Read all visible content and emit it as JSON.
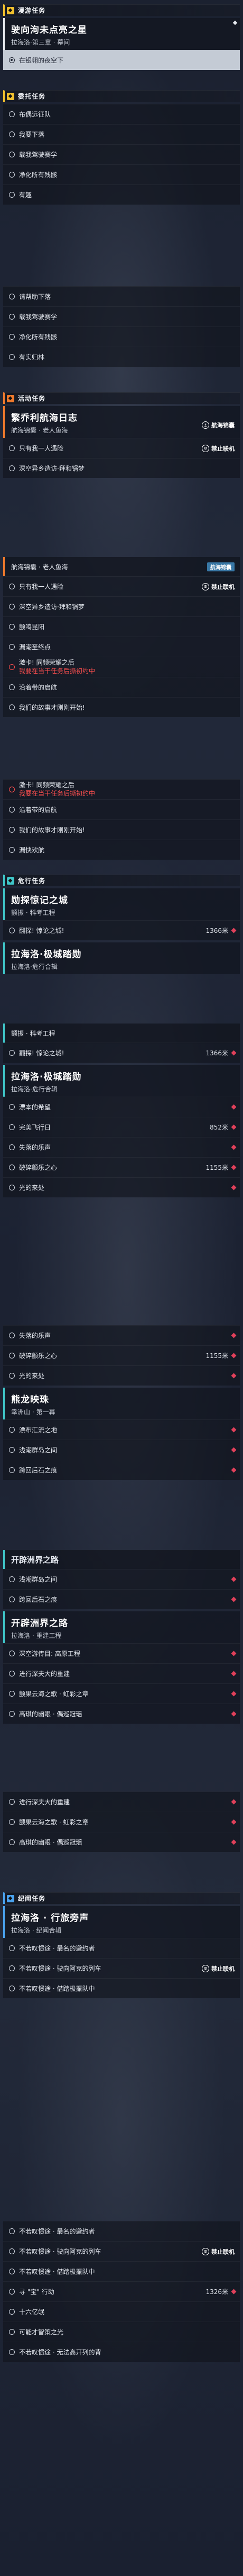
{
  "top": {
    "category": "漫游任务",
    "card_title": "驶向洵未点亮之星",
    "card_sub": "拉海洛·第三章 · 幕间",
    "active_obj": "在银翎的夜空下"
  },
  "daily": {
    "category": "委托任务",
    "items": [
      "布偶远征队",
      "我要下落",
      "载我驾驶赛学",
      "净化所有残骸",
      "有趣"
    ],
    "items_b": [
      "请帮助下落",
      "载我驾驶赛学",
      "净化所有残骸",
      "有实归林"
    ]
  },
  "activity": {
    "category": "活动任务",
    "card_title": "繁乔利航海日志",
    "card_sub": "航海锦囊 · 老人鱼海",
    "badge_online": "航海锦囊",
    "badge_offline": "禁止联机",
    "obj1": "只有我一人遇险",
    "obj2": "深空异乡造访·拜和锅梦",
    "card2_sub": "航海锦囊 · 老人鱼海",
    "obj3": "只有我一人遇险",
    "obj4": "深空异乡造访·拜和锅梦",
    "obj5": "颤鸣昆阳",
    "obj6": "漏潮至终点",
    "red_line1": "激卡! 同频荣耀之后",
    "red_line2": "我要在当干任务后撕初约中",
    "obj7": "沿着带的启航",
    "obj8": "我们的故事才刚刚开始!",
    "red_b1": "激卡! 同频荣耀之后",
    "red_b2": "我要在当干任务后撕初约中",
    "obj9": "沿着带的启航",
    "obj10": "我们的故事才刚刚开始!",
    "obj11": "漏快欢航"
  },
  "explore": {
    "category": "危行任务",
    "card1_title": "勋探惊记之城",
    "card1_sub": "颤振 · 科考工程",
    "obj1": "翻探! 惊论之城!",
    "obj1_dist": "1366米",
    "card2_title": "拉海洛·极城踏勋",
    "card2_sub": "拉海洛·危行合辑",
    "sub_hdr": "颤振 · 科考工程",
    "obj2": "翻探! 惊论之城!",
    "obj2_dist": "1366米",
    "card3_title": "拉海洛·极城踏勋",
    "card3_sub": "拉海洛·危行合辑",
    "list1": [
      "漂本的希望",
      "完美飞行日",
      "失落的乐声",
      "破碎颤乐之心",
      "光的来处"
    ],
    "list1_dist": [
      "",
      "852米",
      "",
      "1155米",
      ""
    ],
    "list2": [
      "失落的乐声",
      "破碎颤乐之心",
      "光的来处"
    ],
    "list2_dist": [
      "",
      "1155米",
      ""
    ],
    "card4_title": "熊龙映珠",
    "card4_sub": "幸洲山 · 第一幕",
    "list3": [
      "漂布汇流之地",
      "浅潮群岛之间",
      "跨回后石之痕"
    ],
    "hdr_partial": "开辟洲界之路",
    "list4": [
      "浅潮群岛之间",
      "跨回后石之痕"
    ],
    "card5_title": "开辟洲界之路",
    "card5_sub": "拉海洛 · 重建工程",
    "list5": [
      "深空游传目: 高原工程",
      "进行深夫大的重建",
      "颤果云海之歌 · 虹彩之章",
      "高琪的幽眼 · 偶巡冠瑶"
    ],
    "list6": [
      "进行深夫大的重建",
      "颤果云海之歌 · 虹彩之章",
      "高琪的幽眼 · 偶巡冠瑶"
    ]
  },
  "record": {
    "category": "纪闻任务",
    "card_title": "拉海洛 · 行旅旁声",
    "card_sub": "拉海洛 · 纪闻合辑",
    "badge_offline": "禁止联机",
    "list1": [
      "不若叹惯途 · 最名的避约者",
      "不若叹惯途 · 驶向阿克的列车",
      "不若叹惯途 · 借踏极振队中"
    ],
    "list2": [
      "不若叹惯途 · 最名的避约者",
      "不若叹惯途 · 驶向阿克的列车",
      "不若叹惯途 · 借踏极振队中",
      "寻 \"宝\" 行动",
      "十六亿氓",
      "可能才智策之光",
      "不若叹惯途 · 无法高开列的背"
    ],
    "list2_dist": [
      "",
      "",
      "",
      "1326米",
      "",
      "",
      ""
    ]
  }
}
